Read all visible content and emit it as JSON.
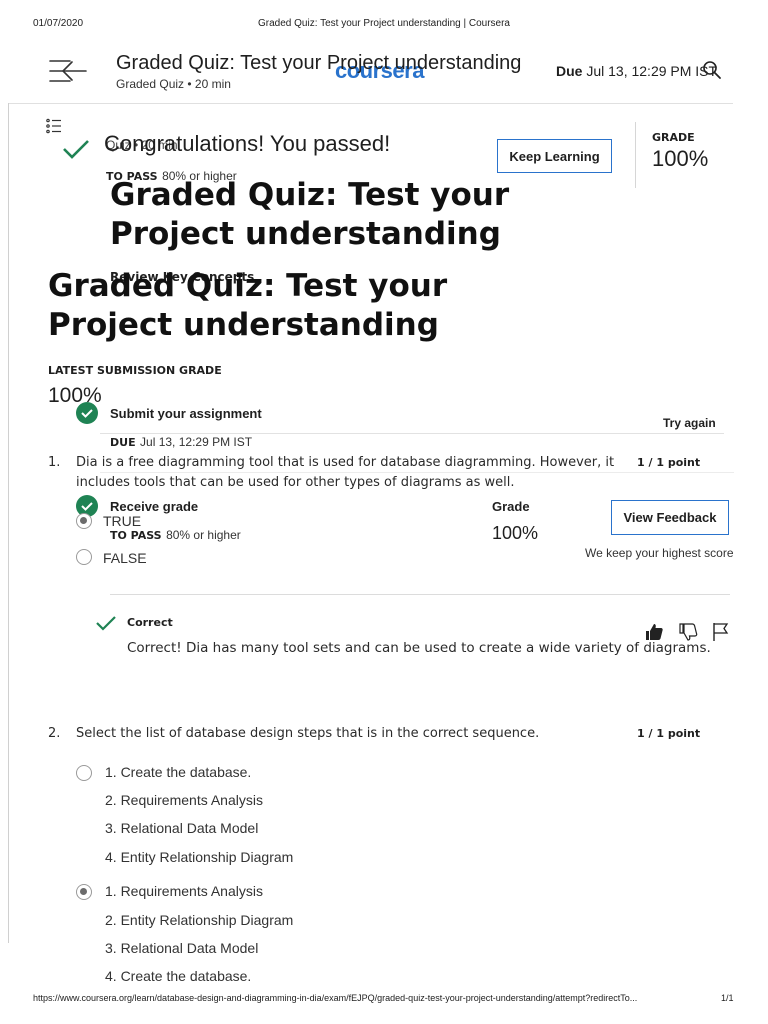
{
  "print_header": {
    "date": "01/07/2020",
    "title": "Graded Quiz: Test your Project understanding | Coursera"
  },
  "header": {
    "title": "Graded Quiz: Test your Project understanding",
    "subtitle": "Graded Quiz • 20 min",
    "brand": "coursera",
    "due_label": "Due",
    "due_value": "Jul 13, 12:29 PM IST"
  },
  "result": {
    "overlap_text": "Quiz • 20 min",
    "congrats": "Congratulations! You passed!",
    "to_pass_label": "TO PASS",
    "to_pass_value": "80% or higher",
    "keep_learning": "Keep Learning",
    "grade_label": "GRADE",
    "grade_value": "100%"
  },
  "quiz_title_1": "Graded Quiz: Test your Project understanding",
  "review_key_concepts": "Review Key Concepts",
  "quiz_title_2": "Graded Quiz: Test your Project understanding",
  "latest": {
    "label": "LATEST SUBMISSION GRADE",
    "value": "100%"
  },
  "submit": {
    "title": "Submit your assignment",
    "due_label": "DUE",
    "due_value": "Jul 13, 12:29 PM IST",
    "try_again": "Try again"
  },
  "receive": {
    "title": "Receive grade",
    "to_pass_label": "TO PASS",
    "to_pass_value": "80% or higher",
    "grade_label": "Grade",
    "grade_value": "100%",
    "view_feedback": "View Feedback",
    "highest_note": "We keep your highest score"
  },
  "questions": [
    {
      "number": "1.",
      "text_line1": "Dia is a free diagramming tool that is used for database diagramming. However, it",
      "text_line2": "includes tools that can be used for other types of diagrams as well.",
      "points": "1 / 1 point",
      "options": [
        "TRUE",
        "FALSE"
      ],
      "selected_index": 0,
      "feedback_label": "Correct",
      "feedback_text": "Correct! Dia has many tool sets and can be used to create a wide variety of diagrams."
    },
    {
      "number": "2.",
      "text_line1": "Select the list of database design steps that is in the correct sequence.",
      "points": "1 / 1 point",
      "option_a": [
        "1. Create the database.",
        "2. Requirements Analysis",
        "3. Relational Data Model",
        "4. Entity Relationship Diagram"
      ],
      "option_b": [
        "1. Requirements Analysis",
        "2. Entity Relationship Diagram",
        "3. Relational Data Model",
        "4. Create the database."
      ],
      "selected_option": "b"
    }
  ],
  "icons": {
    "menu": "back-arrow-menu-icon",
    "search": "search-icon",
    "toc": "list-icon",
    "check": "check-icon",
    "like": "thumbs-up-icon",
    "dislike": "thumbs-down-icon",
    "flag": "flag-icon"
  },
  "colors": {
    "accent": "#2a73cc",
    "success": "#1f8354",
    "check_green": "#1f8354"
  },
  "footer": {
    "url": "https://www.coursera.org/learn/database-design-and-diagramming-in-dia/exam/fEJPQ/graded-quiz-test-your-project-understanding/attempt?redirectTo...",
    "page": "1/1"
  }
}
